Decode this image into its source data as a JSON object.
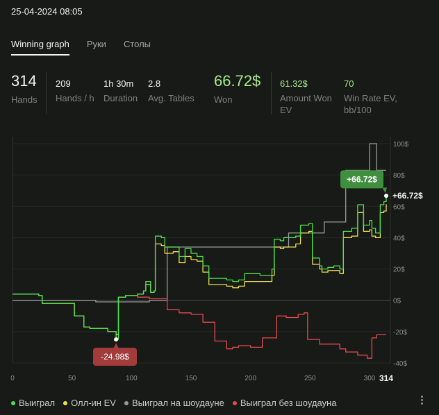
{
  "header": {
    "session_date": "25-04-2024 08:05"
  },
  "tabs": [
    {
      "label": "Winning graph",
      "active": true
    },
    {
      "label": "Руки",
      "active": false
    },
    {
      "label": "Столы",
      "active": false
    }
  ],
  "stats": {
    "hands": {
      "value": "314",
      "label": "Hands"
    },
    "hands_per_hour": {
      "value": "209",
      "label": "Hands / h"
    },
    "duration": {
      "value": "1h 30m",
      "label": "Duration"
    },
    "avg_tables": {
      "value": "2.8",
      "label": "Avg. Tables"
    },
    "won": {
      "value": "66.72$",
      "label": "Won"
    },
    "amount_won_ev": {
      "value": "61.32$",
      "label": "Amount Won EV"
    },
    "win_rate_ev": {
      "value": "70",
      "label": "Win Rate EV, bb/100"
    }
  },
  "legend": [
    {
      "label": "Выиграл",
      "color": "#4ee14e"
    },
    {
      "label": "Олл-ин EV",
      "color": "#f0e04c"
    },
    {
      "label": "Выиграл на шоудауне",
      "color": "#9a9a9a"
    },
    {
      "label": "Выиграл без шоудауна",
      "color": "#e54b4b"
    }
  ],
  "more_icon": "more-vertical-icon",
  "chart_data": {
    "type": "line",
    "x_ticks": [
      "0",
      "50",
      "100",
      "150",
      "200",
      "250",
      "300"
    ],
    "x_end_label": "314",
    "y_ticks": [
      "100$",
      "80$",
      "60$",
      "40$",
      "20$",
      "0$",
      "-20$",
      "-40$"
    ],
    "xlim": [
      0,
      314
    ],
    "ylim": [
      -40,
      100
    ],
    "annotations": {
      "max": {
        "label": "+66.72$",
        "x": 314,
        "y": 66.72,
        "color": "#3f8f3f"
      },
      "min": {
        "label": "-24.98$",
        "x": 87,
        "y": -24.98,
        "color": "#a33b3b"
      },
      "end_label": "+66.72$"
    },
    "series": [
      {
        "name": "Выиграл",
        "color": "#4ee14e",
        "points": [
          [
            0,
            4
          ],
          [
            12,
            4
          ],
          [
            22,
            3
          ],
          [
            25,
            -2
          ],
          [
            45,
            -2
          ],
          [
            52,
            -10
          ],
          [
            60,
            -17
          ],
          [
            65,
            -18
          ],
          [
            75,
            -18
          ],
          [
            80,
            -20
          ],
          [
            87,
            -24.98
          ],
          [
            89,
            2
          ],
          [
            95,
            3
          ],
          [
            105,
            4
          ],
          [
            110,
            6
          ],
          [
            112,
            12
          ],
          [
            116,
            5
          ],
          [
            119,
            6
          ],
          [
            120,
            41
          ],
          [
            125,
            40
          ],
          [
            128,
            34
          ],
          [
            135,
            34
          ],
          [
            140,
            28
          ],
          [
            145,
            33
          ],
          [
            150,
            30
          ],
          [
            155,
            28
          ],
          [
            160,
            22
          ],
          [
            165,
            14
          ],
          [
            180,
            13
          ],
          [
            185,
            12
          ],
          [
            190,
            13
          ],
          [
            195,
            17
          ],
          [
            208,
            16
          ],
          [
            218,
            20
          ],
          [
            220,
            39
          ],
          [
            225,
            38
          ],
          [
            228,
            40
          ],
          [
            238,
            41
          ],
          [
            242,
            48
          ],
          [
            249,
            49
          ],
          [
            252,
            27
          ],
          [
            258,
            22
          ],
          [
            260,
            20
          ],
          [
            265,
            21
          ],
          [
            270,
            22
          ],
          [
            275,
            20
          ],
          [
            278,
            44
          ],
          [
            285,
            46
          ],
          [
            290,
            61
          ],
          [
            295,
            48
          ],
          [
            300,
            51
          ],
          [
            302,
            46
          ],
          [
            305,
            43
          ],
          [
            309,
            61
          ],
          [
            312,
            63
          ],
          [
            314,
            66.72
          ]
        ]
      },
      {
        "name": "Олл-ин EV",
        "color": "#f0e04c",
        "points": [
          [
            0,
            4
          ],
          [
            12,
            4
          ],
          [
            22,
            3
          ],
          [
            25,
            -2
          ],
          [
            45,
            -2
          ],
          [
            52,
            -10
          ],
          [
            60,
            -17
          ],
          [
            65,
            -18
          ],
          [
            75,
            -18
          ],
          [
            80,
            -20
          ],
          [
            87,
            -22
          ],
          [
            89,
            2
          ],
          [
            95,
            3
          ],
          [
            105,
            4
          ],
          [
            110,
            6
          ],
          [
            112,
            10
          ],
          [
            116,
            5
          ],
          [
            119,
            6
          ],
          [
            120,
            36
          ],
          [
            125,
            35
          ],
          [
            128,
            30
          ],
          [
            135,
            31
          ],
          [
            140,
            24
          ],
          [
            145,
            28
          ],
          [
            150,
            26
          ],
          [
            155,
            25
          ],
          [
            160,
            18
          ],
          [
            165,
            10
          ],
          [
            180,
            9
          ],
          [
            185,
            8
          ],
          [
            190,
            9
          ],
          [
            195,
            12
          ],
          [
            208,
            12
          ],
          [
            218,
            16
          ],
          [
            220,
            34
          ],
          [
            225,
            33
          ],
          [
            228,
            34
          ],
          [
            238,
            36
          ],
          [
            242,
            43
          ],
          [
            249,
            44
          ],
          [
            252,
            23
          ],
          [
            258,
            20
          ],
          [
            260,
            18
          ],
          [
            265,
            19
          ],
          [
            270,
            19
          ],
          [
            275,
            17
          ],
          [
            278,
            40
          ],
          [
            285,
            41
          ],
          [
            290,
            56
          ],
          [
            295,
            44
          ],
          [
            300,
            45
          ],
          [
            302,
            41
          ],
          [
            305,
            40
          ],
          [
            309,
            56
          ],
          [
            312,
            57
          ],
          [
            314,
            61.32
          ]
        ]
      },
      {
        "name": "Выиграл на шоудауне",
        "color": "#9a9a9a",
        "points": [
          [
            0,
            0
          ],
          [
            60,
            0
          ],
          [
            65,
            0
          ],
          [
            70,
            -1
          ],
          [
            110,
            -1
          ],
          [
            115,
            0
          ],
          [
            120,
            0
          ],
          [
            125,
            0
          ],
          [
            130,
            34
          ],
          [
            230,
            34
          ],
          [
            232,
            43
          ],
          [
            260,
            43
          ],
          [
            262,
            50
          ],
          [
            270,
            50
          ],
          [
            274,
            50
          ],
          [
            280,
            83
          ],
          [
            298,
            83
          ],
          [
            300,
            100
          ],
          [
            304,
            100
          ],
          [
            306,
            83
          ],
          [
            314,
            83
          ]
        ]
      },
      {
        "name": "Выиграл без шоудауна",
        "color": "#e54b4b",
        "points": [
          [
            0,
            4
          ],
          [
            12,
            4
          ],
          [
            22,
            3
          ],
          [
            25,
            -2
          ],
          [
            45,
            -2
          ],
          [
            52,
            -10
          ],
          [
            60,
            -17
          ],
          [
            65,
            -18
          ],
          [
            75,
            -18
          ],
          [
            80,
            -20
          ],
          [
            87,
            -24
          ],
          [
            89,
            2
          ],
          [
            95,
            3
          ],
          [
            105,
            2
          ],
          [
            115,
            1
          ],
          [
            125,
            1
          ],
          [
            130,
            -6
          ],
          [
            140,
            -8
          ],
          [
            150,
            -9
          ],
          [
            160,
            -14
          ],
          [
            170,
            -26
          ],
          [
            180,
            -31
          ],
          [
            185,
            -30
          ],
          [
            190,
            -29
          ],
          [
            200,
            -30
          ],
          [
            210,
            -24
          ],
          [
            220,
            -24
          ],
          [
            222,
            -10
          ],
          [
            230,
            -11
          ],
          [
            240,
            -9
          ],
          [
            245,
            -8
          ],
          [
            248,
            -25
          ],
          [
            258,
            -28
          ],
          [
            265,
            -28
          ],
          [
            275,
            -31
          ],
          [
            280,
            -33
          ],
          [
            285,
            -33
          ],
          [
            290,
            -35
          ],
          [
            298,
            -37
          ],
          [
            302,
            -24
          ],
          [
            306,
            -22
          ],
          [
            314,
            -22
          ]
        ]
      }
    ]
  }
}
